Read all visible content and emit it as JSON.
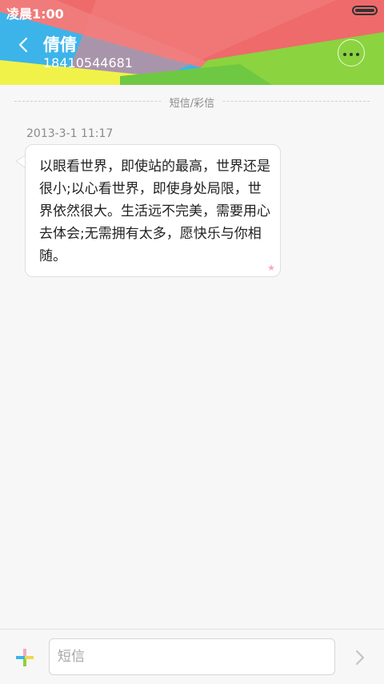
{
  "status_bar": {
    "time": "凌晨1:00"
  },
  "header": {
    "contact_name": "倩倩",
    "contact_number": "18410544681"
  },
  "thread": {
    "divider_label": "短信/彩信",
    "messages": [
      {
        "timestamp": "2013-3-1 11:17",
        "text": "以眼看世界，即使站的最高，世界还是很小;以心看世界，即使身处局限，世界依然很大。生活远不完美，需要用心去体会;无需拥有太多，愿快乐与你相随。"
      }
    ]
  },
  "compose": {
    "placeholder": "短信",
    "value": ""
  },
  "colors": {
    "header_red": "#ef6a6a",
    "header_blue": "#3cb4ea",
    "header_green": "#8bd33f",
    "header_yellow": "#f0f24a",
    "star_pink": "#f4a9c4"
  },
  "icons": {
    "back": "chevron-left-icon",
    "more": "more-dots-icon",
    "add": "plus-icon",
    "send": "chevron-right-icon",
    "star": "star-icon"
  }
}
